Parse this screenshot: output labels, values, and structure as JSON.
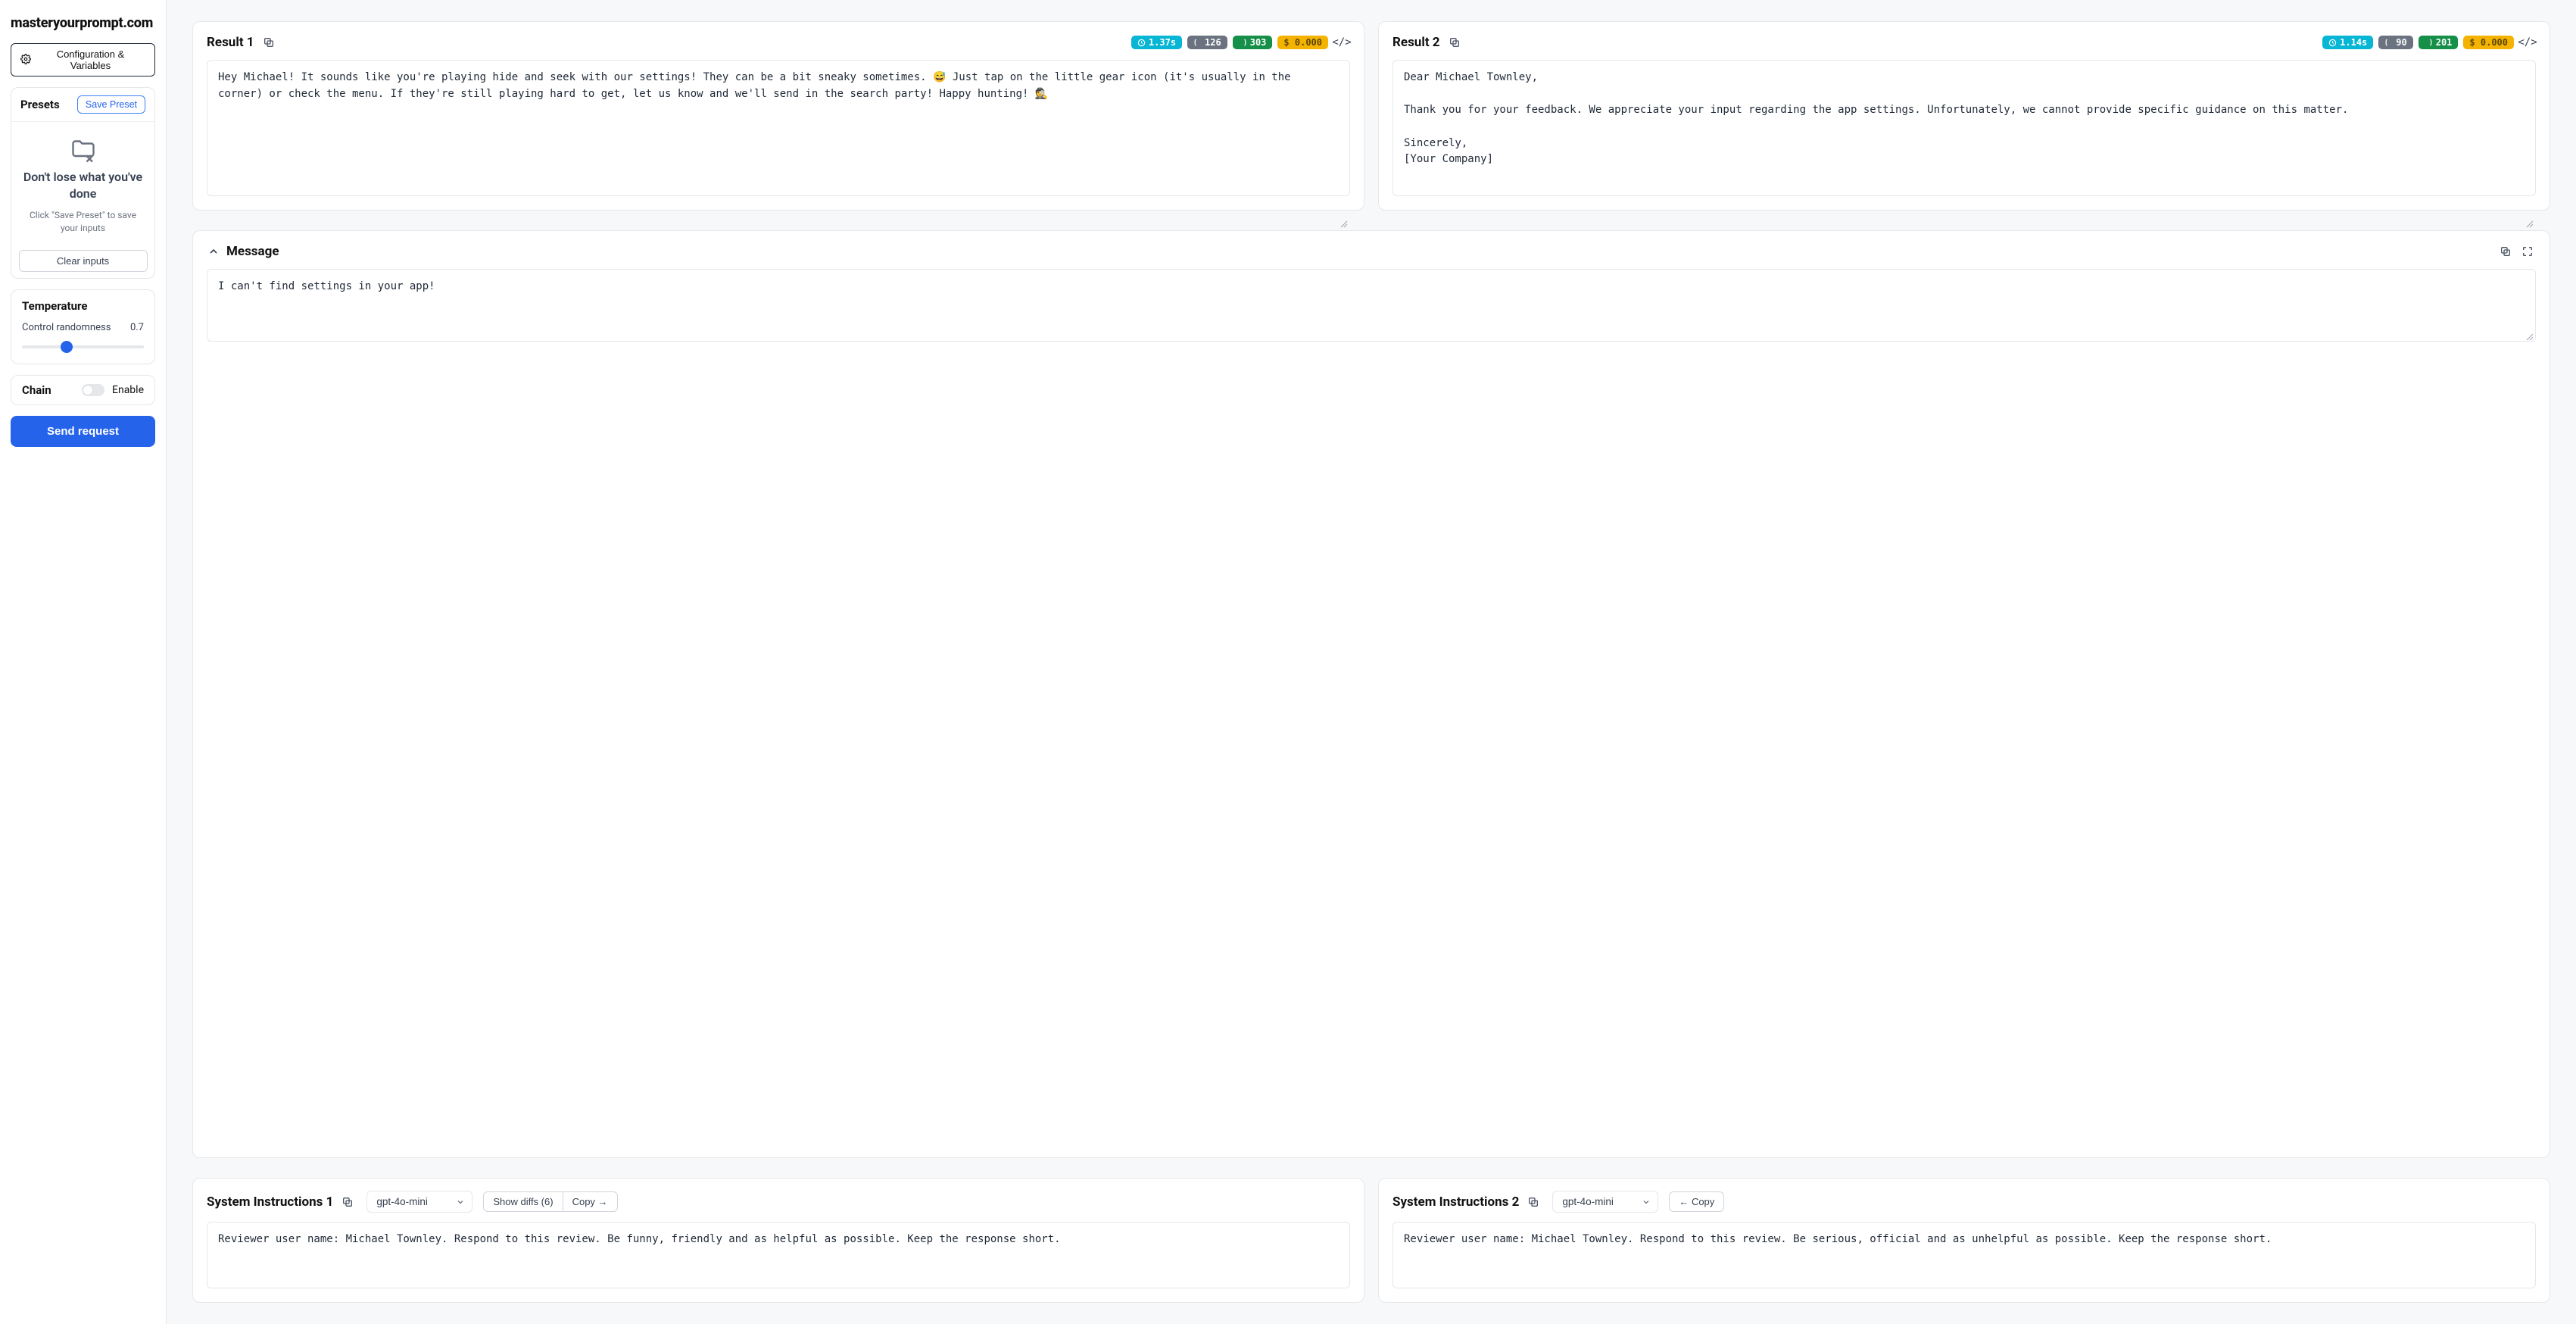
{
  "logo": "masteryourprompt.com",
  "sidebar": {
    "config_button": "Configuration & Variables",
    "presets": {
      "title": "Presets",
      "save_btn": "Save Preset",
      "headline": "Don't lose what you've done",
      "sub": "Click \"Save Preset\" to save your inputs",
      "clear_btn": "Clear inputs"
    },
    "temperature": {
      "title": "Temperature",
      "label": "Control randomness",
      "value": "0.7"
    },
    "chain": {
      "title": "Chain",
      "enable": "Enable"
    },
    "send_btn": "Send request"
  },
  "result1": {
    "title": "Result 1",
    "time": "1.37s",
    "tokens_gray": "126",
    "tokens_green": "303",
    "cost": "$ 0.000",
    "output": "Hey Michael! It sounds like you're playing hide and seek with our settings! They can be a bit sneaky sometimes. 😅 Just tap on the little gear icon (it's usually in the corner) or check the menu. If they're still playing hard to get, let us know and we'll send in the search party! Happy hunting! 🕵️"
  },
  "result2": {
    "title": "Result 2",
    "time": "1.14s",
    "tokens_gray": "90",
    "tokens_green": "201",
    "cost": "$ 0.000",
    "output": "Dear Michael Townley,\n\nThank you for your feedback. We appreciate your input regarding the app settings. Unfortunately, we cannot provide specific guidance on this matter.\n\nSincerely,\n[Your Company]"
  },
  "message": {
    "title": "Message",
    "text": "I can't find settings in your app!"
  },
  "instr1": {
    "title": "System Instructions 1",
    "model": "gpt-4o-mini",
    "show_diffs": "Show diffs (6)",
    "copy_btn": "Copy →",
    "text": "Reviewer user name: Michael Townley.\nRespond to this review. Be funny, friendly and as helpful as possible. Keep the response short."
  },
  "instr2": {
    "title": "System Instructions 2",
    "model": "gpt-4o-mini",
    "copy_btn": "← Copy",
    "text": "Reviewer user name: Michael Townley.\nRespond to this review. Be serious, official and as unhelpful as possible. Keep the response short."
  }
}
